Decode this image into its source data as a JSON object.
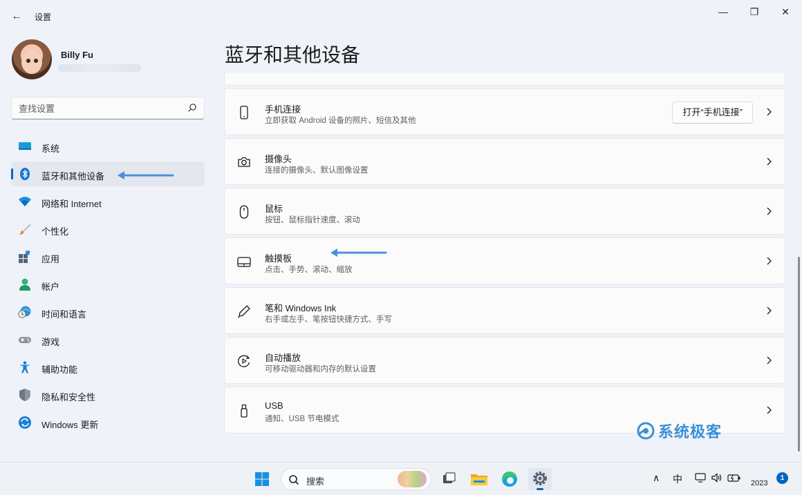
{
  "window": {
    "title": "设置",
    "back_glyph": "←",
    "minimize_glyph": "—",
    "maximize_glyph": "❐",
    "close_glyph": "✕"
  },
  "profile": {
    "name": "Billy Fu"
  },
  "search": {
    "placeholder": "查找设置"
  },
  "sidebar": {
    "items": [
      {
        "label": "系统",
        "icon": "monitor-icon",
        "active": false
      },
      {
        "label": "蓝牙和其他设备",
        "icon": "bluetooth-icon",
        "active": true
      },
      {
        "label": "网络和 Internet",
        "icon": "wifi-icon",
        "active": false
      },
      {
        "label": "个性化",
        "icon": "paintbrush-icon",
        "active": false
      },
      {
        "label": "应用",
        "icon": "apps-icon",
        "active": false
      },
      {
        "label": "帐户",
        "icon": "person-icon",
        "active": false
      },
      {
        "label": "时间和语言",
        "icon": "globe-clock-icon",
        "active": false
      },
      {
        "label": "游戏",
        "icon": "gamepad-icon",
        "active": false
      },
      {
        "label": "辅助功能",
        "icon": "accessibility-icon",
        "active": false
      },
      {
        "label": "隐私和安全性",
        "icon": "shield-icon",
        "active": false
      },
      {
        "label": "Windows 更新",
        "icon": "update-icon",
        "active": false
      }
    ]
  },
  "main": {
    "page_title": "蓝牙和其他设备",
    "cards": [
      {
        "title": "手机连接",
        "desc": "立即获取 Android 设备的照片、短信及其他",
        "icon": "phone-icon",
        "action_label": "打开“手机连接”"
      },
      {
        "title": "摄像头",
        "desc": "连接的摄像头、默认图像设置",
        "icon": "camera-icon"
      },
      {
        "title": "鼠标",
        "desc": "按钮、鼠标指针速度、滚动",
        "icon": "mouse-icon"
      },
      {
        "title": "触摸板",
        "desc": "点击、手势、滚动、缩放",
        "icon": "touchpad-icon"
      },
      {
        "title": "笔和 Windows Ink",
        "desc": "右手或左手、笔按钮快捷方式、手写",
        "icon": "pen-icon"
      },
      {
        "title": "自动播放",
        "desc": "可移动驱动器和内存的默认设置",
        "icon": "autoplay-icon"
      },
      {
        "title": "USB",
        "desc": "通知、USB 节电模式",
        "icon": "usb-icon"
      }
    ]
  },
  "watermark": {
    "text": "系统极客"
  },
  "taskbar": {
    "search_label": "搜索",
    "ime_label": "中",
    "tray_up_glyph": "∧",
    "year": "2023",
    "notification_count": "1"
  },
  "colors": {
    "accent": "#0067c0",
    "annotation_arrow": "#4a90d9",
    "background": "#eff2f8",
    "card": "#fbfbfc"
  }
}
